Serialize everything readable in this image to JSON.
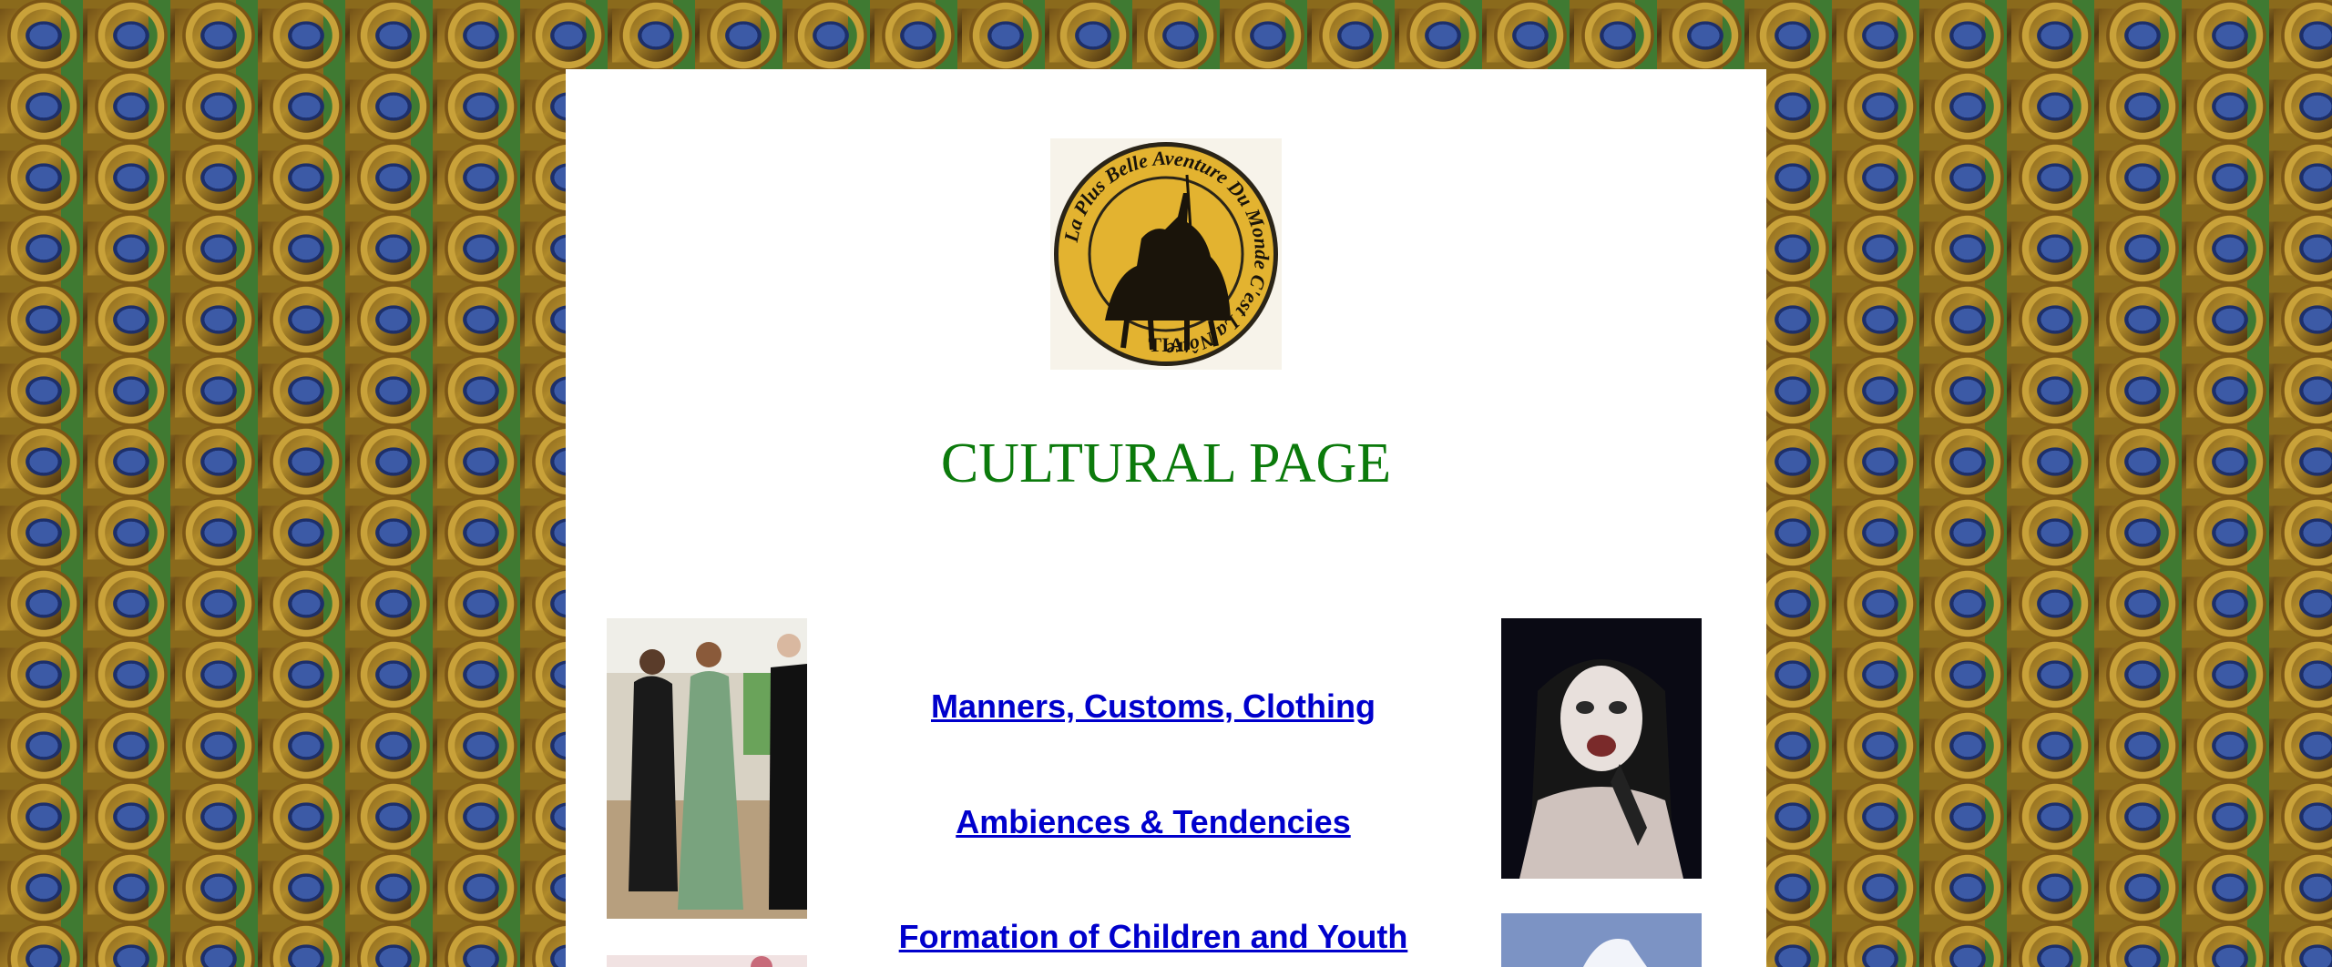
{
  "title": "CULTURAL PAGE",
  "seal": {
    "ring_text": "La Plus Belle Aventure Du Monde C'est La Nôtre",
    "bottom_text": "TIA"
  },
  "links": [
    "Manners, Customs, Clothing",
    "Ambiences & Tendencies",
    "Formation of Children and Youth"
  ],
  "colors": {
    "title": "#0b7a0b",
    "link": "#0000cc",
    "seal_gold": "#e3b330"
  }
}
